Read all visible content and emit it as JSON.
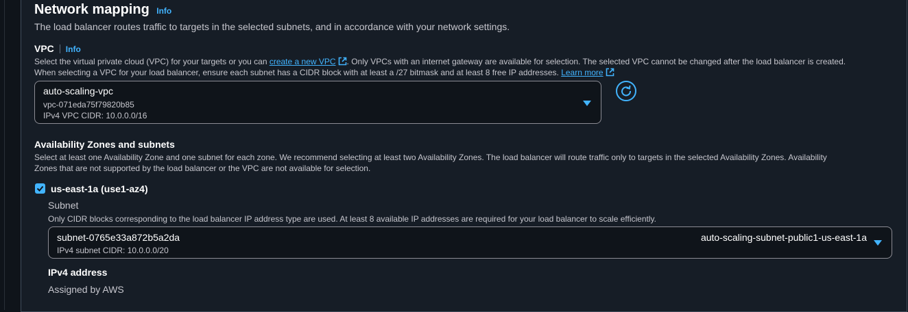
{
  "network": {
    "title": "Network mapping",
    "info": "Info",
    "description": "The load balancer routes traffic to targets in the selected subnets, and in accordance with your network settings."
  },
  "vpc": {
    "label": "VPC",
    "info": "Info",
    "desc_part1": "Select the virtual private cloud (VPC) for your targets or you can ",
    "create_link": "create a new VPC",
    "desc_part2": ". Only VPCs with an internet gateway are available for selection. The selected VPC cannot be changed after the load balancer is created.",
    "desc_line2": "When selecting a VPC for your load balancer, ensure each subnet has a CIDR block with at least a /27 bitmask and at least 8 free IP addresses. ",
    "learn_more": "Learn more",
    "selected_name": "auto-scaling-vpc",
    "selected_id": "vpc-071eda75f79820b85",
    "selected_cidr": "IPv4 VPC CIDR: 10.0.0.0/16"
  },
  "az": {
    "label": "Availability Zones and subnets",
    "desc_line1": "Select at least one Availability Zone and one subnet for each zone. We recommend selecting at least two Availability Zones. The load balancer will route traffic only to targets in the selected Availability Zones. Availability",
    "desc_line2": "Zones that are not supported by the load balancer or the VPC are not available for selection.",
    "zone_label": "us-east-1a (use1-az4)",
    "zone_checked": true,
    "subnet_label": "Subnet",
    "subnet_desc": "Only CIDR blocks corresponding to the load balancer IP address type are used. At least 8 available IP addresses are required for your load balancer to scale efficiently.",
    "subnet_id": "subnet-0765e33a872b5a2da",
    "subnet_name": "auto-scaling-subnet-public1-us-east-1a",
    "subnet_cidr": "IPv4 subnet CIDR: 10.0.0.0/20",
    "ipv4_label": "IPv4 address",
    "ipv4_value": "Assigned by AWS"
  },
  "colors": {
    "accent": "#42b4ff",
    "background": "#161d26",
    "border": "#414d5c"
  },
  "icons": [
    "external-link-icon",
    "refresh-icon",
    "caret-down-icon",
    "checkmark-icon"
  ]
}
